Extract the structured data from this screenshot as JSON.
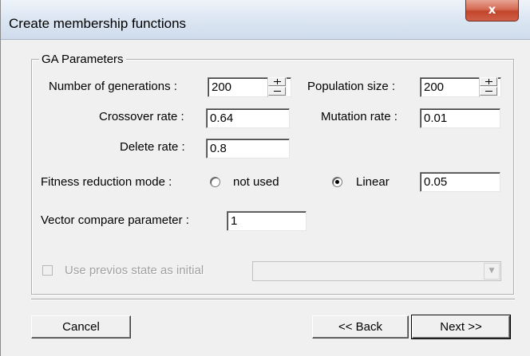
{
  "window": {
    "title": "Create membership functions",
    "close_glyph": "x"
  },
  "ga_parameters": {
    "legend": "GA Parameters",
    "generations": {
      "label": "Number of generations :",
      "value": "200"
    },
    "population": {
      "label": "Population size :",
      "value": "200"
    },
    "crossover": {
      "label": "Crossover rate :",
      "value": "0.64"
    },
    "mutation": {
      "label": "Mutation rate :",
      "value": "0.01"
    },
    "delete": {
      "label": "Delete rate :",
      "value": "0.8"
    },
    "fitness": {
      "label": "Fitness reduction mode :",
      "option_not_used": "not used",
      "option_linear": "Linear",
      "selected": "Linear",
      "value": "0.05"
    },
    "vector_compare": {
      "label": "Vector compare parameter :",
      "value": "1"
    },
    "previous_state": {
      "label": "Use previos state as initial",
      "checked": false,
      "enabled": false,
      "combo_value": ""
    }
  },
  "buttons": {
    "cancel": "Cancel",
    "back": "<< Back",
    "next": "Next >>"
  },
  "colors": {
    "face": "#f0f0f0",
    "close_button": "#c2452b",
    "disabled_text": "#a0a0a0"
  },
  "icons": {
    "close": "close-icon",
    "spin_up": "plus-icon",
    "spin_down": "minus-icon",
    "combo_arrow": "chevron-down-icon"
  }
}
